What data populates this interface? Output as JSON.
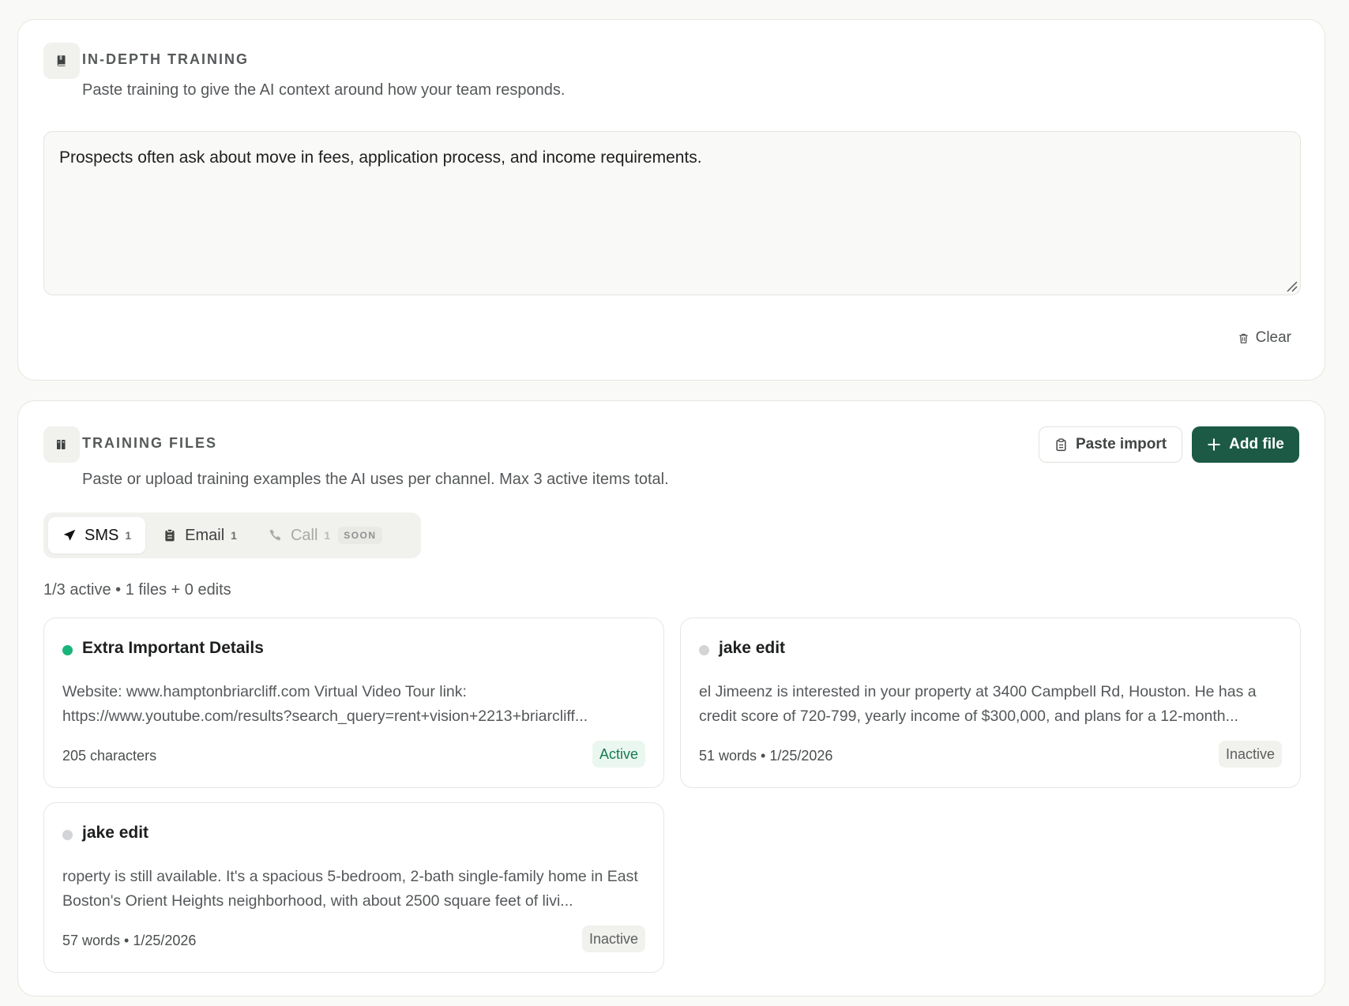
{
  "training": {
    "title": "IN-DEPTH TRAINING",
    "description": "Paste training to give the AI context around how your team responds.",
    "text": "Prospects often ask about move in fees, application process, and income requirements.",
    "clear_label": "Clear"
  },
  "files": {
    "title": "TRAINING FILES",
    "description": "Paste or upload training examples the AI uses per channel. Max 3 active items total.",
    "paste_import_label": "Paste import",
    "add_file_label": "Add file",
    "tabs": [
      {
        "label": "SMS",
        "count": "1"
      },
      {
        "label": "Email",
        "count": "1"
      },
      {
        "label": "Call",
        "count": "1",
        "tag": "SOON"
      }
    ],
    "summary": "1/3 active • 1 files + 0 edits",
    "cards": [
      {
        "title": "Extra Important Details",
        "preview": "Website: www.hamptonbriarcliff.com Virtual Video Tour link: https://www.youtube.com/results?search_query=rent+vision+2213+briarcliff...",
        "meta": "205 characters",
        "status": "Active"
      },
      {
        "title": "jake edit",
        "preview": "el Jimeenz is interested in your property at 3400 Campbell Rd, Houston. He has a credit score of 720-799, yearly income of $300,000, and plans for a 12-month...",
        "meta": "51 words • 1/25/2026",
        "status": "Inactive"
      },
      {
        "title": "jake edit",
        "preview": "roperty is still available. It's a spacious 5-bedroom, 2-bath single-family home in East Boston's Orient Heights neighborhood, with about 2500 square feet of livi...",
        "meta": "57 words • 1/25/2026",
        "status": "Inactive"
      }
    ]
  },
  "colors": {
    "primary": "#1c5a46",
    "active_dot": "#19b47a",
    "inactive_dot": "#d2d4d6",
    "active_badge_text": "#167a52"
  },
  "icons": {
    "training": "book-icon",
    "files": "books-icon",
    "clear": "trash-icon",
    "paste_import": "clipboard-icon",
    "add_file": "plus-icon",
    "sms": "send-icon",
    "email": "clipboard-icon",
    "call": "phone-icon"
  }
}
